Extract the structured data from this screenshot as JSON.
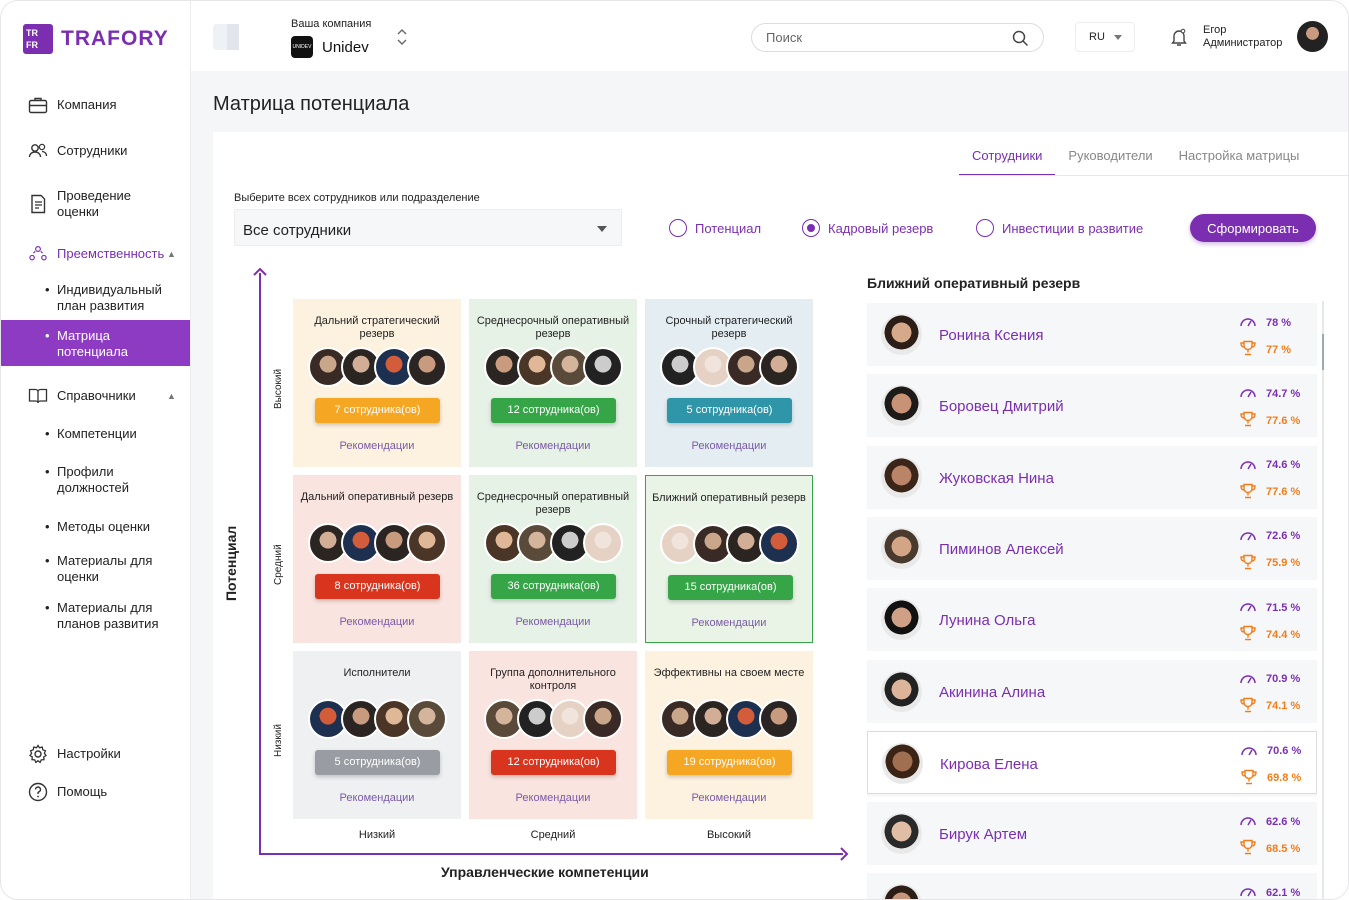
{
  "brand": {
    "logo_letters": [
      "TR",
      "FR"
    ],
    "logo_text": "TRAFORY"
  },
  "sidebar": {
    "items": [
      {
        "label": "Компания",
        "icon": "briefcase-icon"
      },
      {
        "label": "Сотрудники",
        "icon": "users-icon"
      },
      {
        "label": "Проведение оценки",
        "icon": "document-icon"
      },
      {
        "label": "Преемственность",
        "icon": "succession-icon"
      },
      {
        "label": "Справочники",
        "icon": "book-icon"
      },
      {
        "label": "Настройки",
        "icon": "gear-icon"
      },
      {
        "label": "Помощь",
        "icon": "help-icon"
      }
    ],
    "succession_sub": [
      "Индивидуальный план развития",
      "Матрица потенциала"
    ],
    "reference_sub": [
      "Компетенции",
      "Профили должностей",
      "Методы оценки",
      "Материалы для оценки",
      "Материалы для планов развития"
    ]
  },
  "header": {
    "company_label": "Ваша компания",
    "company_logo_text": "UNIDEV",
    "company_name": "Unidev",
    "search_placeholder": "Поиск",
    "lang": "RU",
    "user_name": "Егор",
    "user_role": "Администратор"
  },
  "page": {
    "title": "Матрица потенциала",
    "tabs": [
      "Сотрудники",
      "Руководители",
      "Настройка матрицы"
    ],
    "active_tab": 0,
    "select_label": "Выберите всех сотрудников или подразделение",
    "select_value": "Все сотрудники",
    "radios": [
      {
        "label": "Потенциал",
        "checked": false
      },
      {
        "label": "Кадровый резерв",
        "checked": true
      },
      {
        "label": "Инвестиции в развитие",
        "checked": false
      }
    ],
    "submit_label": "Сформировать"
  },
  "matrix": {
    "y_axis": "Потенциал",
    "x_axis": "Управленческие компетенции",
    "rows": [
      {
        "label": "Высокий",
        "color": "#3aa64a"
      },
      {
        "label": "Средний",
        "color": "#f0a500"
      },
      {
        "label": "Низкий",
        "color": "#d8341e"
      }
    ],
    "cols": [
      {
        "label": "Низкий",
        "color": "#d8341e"
      },
      {
        "label": "Средний",
        "color": "#f0a500"
      },
      {
        "label": "Высокий",
        "color": "#3aa64a"
      }
    ],
    "recommend_label": "Рекомендации",
    "cells": [
      {
        "title": "Дальний стратегический резерв",
        "count": "7 сотрудника(ов)",
        "bg": "#fdf2e0",
        "btn": "#f5a623"
      },
      {
        "title": "Среднесрочный оперативный резерв",
        "count": "12 сотрудника(ов)",
        "bg": "#e6f2e5",
        "btn": "#35a547"
      },
      {
        "title": "Срочный стратегический резерв",
        "count": "5 сотрудника(ов)",
        "bg": "#e4eef2",
        "btn": "#2f95a8"
      },
      {
        "title": "Дальний оперативный резерв",
        "count": "8 сотрудника(ов)",
        "bg": "#fae4e0",
        "btn": "#d8341e"
      },
      {
        "title": "Среднесрочный оперативный резерв",
        "count": "36 сотрудника(ов)",
        "bg": "#e6f2e5",
        "btn": "#35a547"
      },
      {
        "title": "Ближний оперативный резерв",
        "count": "15 сотрудника(ов)",
        "bg": "#e9f4e7",
        "btn": "#35a547"
      },
      {
        "title": "Исполнители",
        "count": "5 сотрудника(ов)",
        "bg": "#eef0f2",
        "btn": "#9a9ca3"
      },
      {
        "title": "Группа дополнительного контроля",
        "count": "12 сотрудника(ов)",
        "bg": "#fae4e0",
        "btn": "#d8341e"
      },
      {
        "title": "Эффективны на своем месте",
        "count": "19 сотрудника(ов)",
        "bg": "#fdf2e0",
        "btn": "#f5a623"
      }
    ]
  },
  "reserve": {
    "title": "Ближний оперативный резерв",
    "people": [
      {
        "name": "Ронина Ксения",
        "m1": "78 %",
        "m2": "77 %"
      },
      {
        "name": "Боровец Дмитрий",
        "m1": "74.7 %",
        "m2": "77.6 %"
      },
      {
        "name": "Жуковская Нина",
        "m1": "74.6 %",
        "m2": "77.6 %"
      },
      {
        "name": "Пиминов Алексей",
        "m1": "72.6 %",
        "m2": "75.9 %"
      },
      {
        "name": "Лунина Ольга",
        "m1": "71.5 %",
        "m2": "74.4 %"
      },
      {
        "name": "Акинина Алина",
        "m1": "70.9 %",
        "m2": "74.1 %"
      },
      {
        "name": "Кирова Елена",
        "m1": "70.6 %",
        "m2": "69.8 %"
      },
      {
        "name": "Бирук Артем",
        "m1": "62.6 %",
        "m2": "68.5 %"
      },
      {
        "name": "",
        "m1": "62.1 %",
        "m2": ""
      }
    ]
  }
}
